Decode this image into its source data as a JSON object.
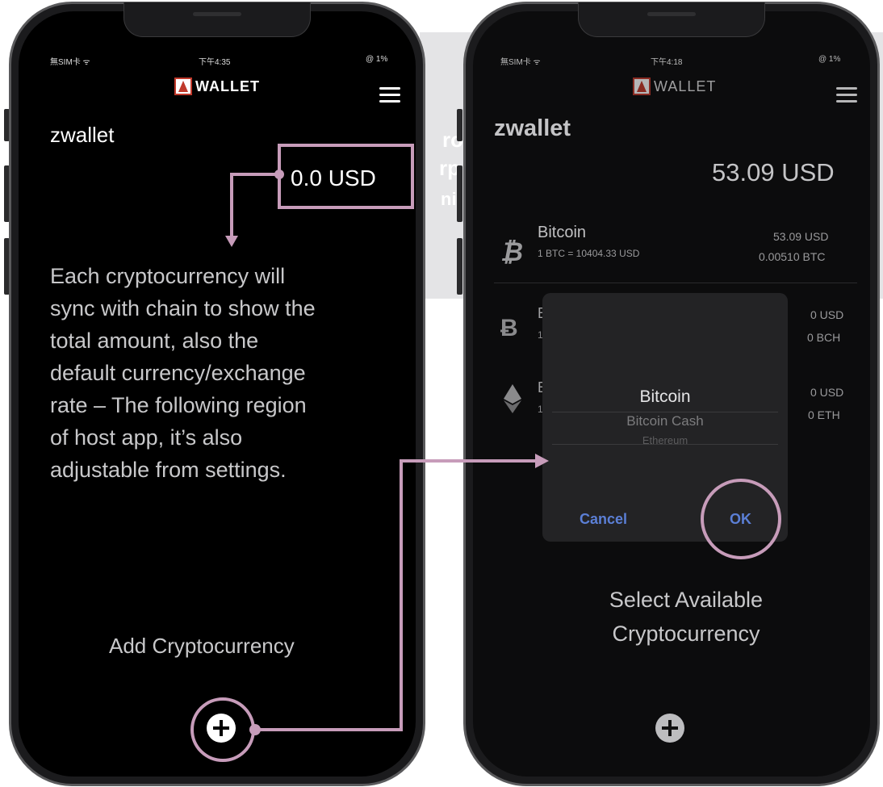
{
  "left_screen": {
    "status": {
      "carrier": "無SIM卡 ᯤ",
      "time": "下午4:35",
      "battery": "@ 1%"
    },
    "brand": "WALLET",
    "wallet_name": "zwallet",
    "balance": "0.0 USD",
    "annotation": "Each cryptocurrency will sync with chain to show the total amount, also the default currency/exchange rate – The following region of host app, it’s also adjustable from settings.",
    "annotation_lines": [
      "Each cryptocurrency will",
      "sync with chain to show the",
      "total amount, also the",
      "default currency/exchange",
      "rate – The following region",
      "of host app, it’s also",
      "adjustable from settings."
    ],
    "add_label": "Add Cryptocurrency"
  },
  "right_screen": {
    "status": {
      "carrier": "無SIM卡 ᯤ",
      "time": "下午4:18",
      "battery": "@ 1%"
    },
    "brand": "WALLET",
    "wallet_name": "zwallet",
    "balance": "53.09 USD",
    "coins": [
      {
        "icon": "bitcoin-icon",
        "name": "Bitcoin",
        "rate": "1 BTC = 10404.33 USD",
        "fiat": "53.09 USD",
        "amount": "0.00510 BTC"
      },
      {
        "icon": "bitcoin-cash-icon",
        "name": "B",
        "rate": "1",
        "fiat": "0 USD",
        "amount": "0 BCH"
      },
      {
        "icon": "ethereum-icon",
        "name": "E",
        "rate": "1",
        "fiat": "0 USD",
        "amount": "0 ETH"
      }
    ],
    "picker": {
      "options": [
        "Bitcoin",
        "Bitcoin Cash",
        "Ethereum"
      ],
      "cancel": "Cancel",
      "ok": "OK"
    },
    "annotation_lines": [
      "Select Available",
      "Cryptocurrency"
    ]
  },
  "background_fragments": [
    "ro",
    "rp",
    "ni"
  ],
  "colors": {
    "annotation": "#c79cba",
    "dialog_button": "#5b7fd6"
  }
}
